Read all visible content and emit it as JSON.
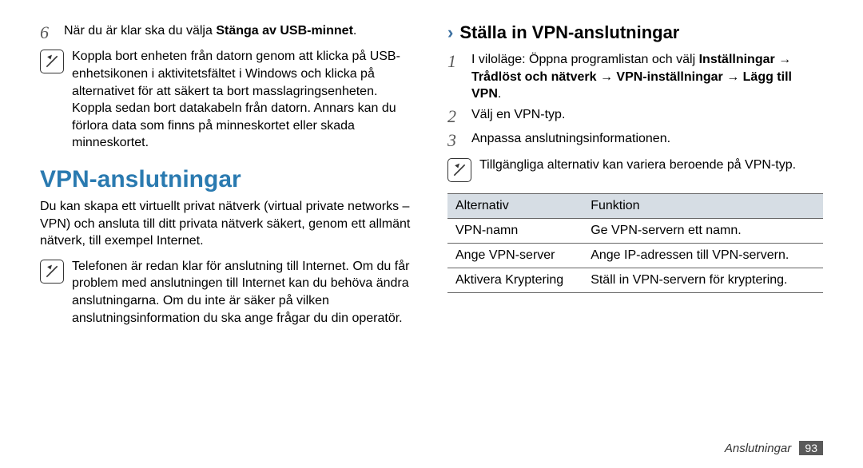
{
  "left": {
    "step6": {
      "num": "6",
      "pre": "När du är klar ska du välja ",
      "bold": "Stänga av USB-minnet",
      "post": "."
    },
    "note1": "Koppla bort enheten från datorn genom att klicka på USB-enhetsikonen i aktivitetsfältet i Windows och klicka på alternativet för att säkert ta bort masslagringsenheten. Koppla sedan bort datakabeln från datorn. Annars kan du förlora data som finns på minneskortet eller skada minneskortet.",
    "sectionTitle": "VPN-anslutningar",
    "intro": "Du kan skapa ett virtuellt privat nätverk (virtual private networks – VPN) och ansluta till ditt privata nätverk säkert, genom ett allmänt nätverk, till exempel Internet.",
    "note2": "Telefonen är redan klar för anslutning till Internet. Om du får problem med anslutningen till Internet kan du behöva ändra anslutningarna. Om du inte är säker på vilken anslutningsinformation du ska ange frågar du din operatör."
  },
  "right": {
    "subheading": "Ställa in VPN-anslutningar",
    "step1": {
      "num": "1",
      "pre": "I viloläge: Öppna programlistan och välj ",
      "b1": "Inställningar",
      "arrow1": " → ",
      "b2": "Trådlöst och nätverk",
      "arrow2": " → ",
      "b3": "VPN-inställningar",
      "arrow3": " → ",
      "b4": "Lägg till VPN",
      "post": "."
    },
    "step2": {
      "num": "2",
      "text": "Välj en VPN-typ."
    },
    "step3": {
      "num": "3",
      "text": "Anpassa anslutningsinformationen."
    },
    "note": "Tillgängliga alternativ kan variera beroende på VPN-typ.",
    "table": {
      "h1": "Alternativ",
      "h2": "Funktion",
      "rows": [
        {
          "c1": "VPN-namn",
          "c2": "Ge VPN-servern ett namn."
        },
        {
          "c1": "Ange VPN-server",
          "c2": "Ange IP-adressen till VPN-servern."
        },
        {
          "c1": "Aktivera Kryptering",
          "c2": "Ställ in VPN-servern för kryptering."
        }
      ]
    }
  },
  "footer": {
    "label": "Anslutningar",
    "page": "93"
  }
}
